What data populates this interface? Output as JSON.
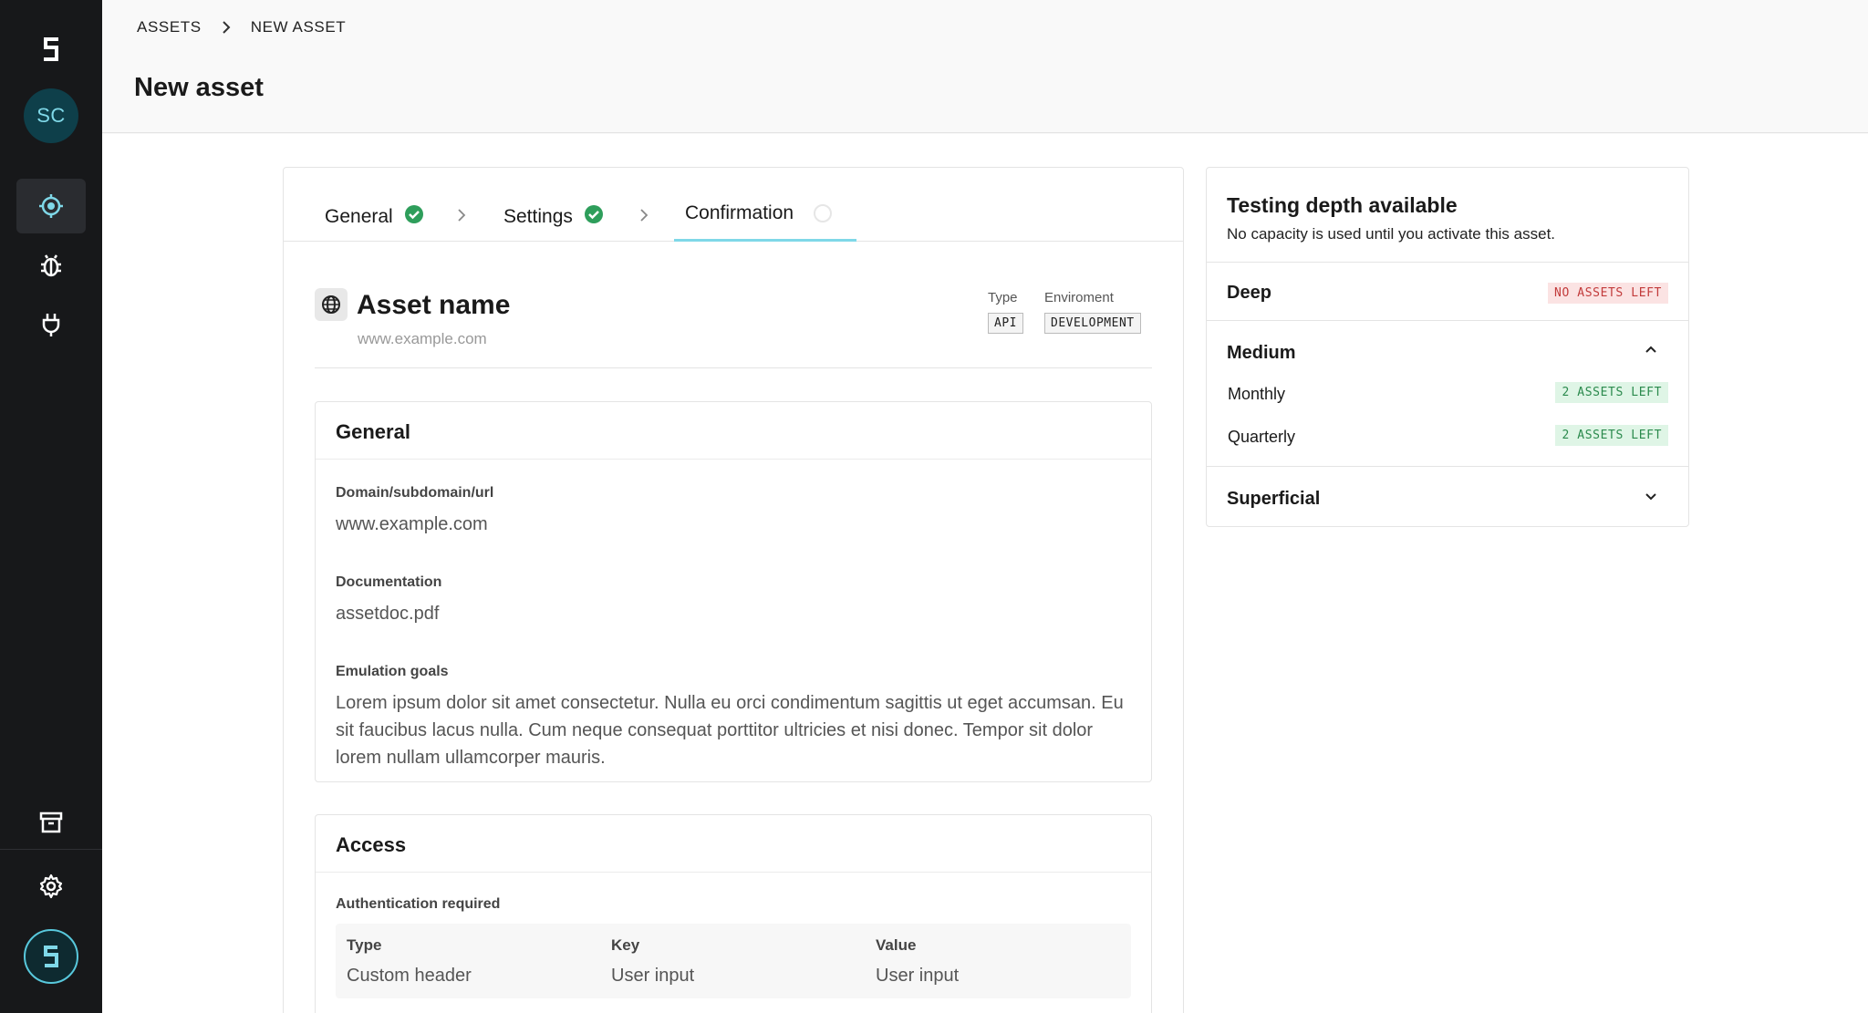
{
  "breadcrumb": {
    "items": [
      "ASSETS",
      "NEW ASSET"
    ]
  },
  "page": {
    "title": "New asset"
  },
  "sidebar": {
    "avatar_initials": "SC",
    "nav": [
      {
        "name": "targets",
        "icon": "crosshair-icon",
        "active": true
      },
      {
        "name": "bugs",
        "icon": "bug-icon",
        "active": false
      },
      {
        "name": "integrations",
        "icon": "plug-icon",
        "active": false
      }
    ],
    "bottom": [
      {
        "name": "archive",
        "icon": "archive-icon"
      },
      {
        "name": "settings",
        "icon": "gear-icon"
      }
    ]
  },
  "wizard": {
    "tabs": [
      {
        "label": "General",
        "status": "complete"
      },
      {
        "label": "Settings",
        "status": "complete"
      },
      {
        "label": "Confirmation",
        "status": "current"
      }
    ],
    "asset": {
      "name": "Asset name",
      "url": "www.example.com",
      "type_label": "Type",
      "type_value": "API",
      "env_label": "Enviroment",
      "env_value": "DEVELOPMENT"
    },
    "general": {
      "title": "General",
      "domain_label": "Domain/subdomain/url",
      "domain_value": "www.example.com",
      "doc_label": "Documentation",
      "doc_value": "assetdoc.pdf",
      "goals_label": "Emulation goals",
      "goals_value": "Lorem ipsum dolor sit amet consectetur. Nulla eu orci condimentum sagittis ut eget accumsan. Eu sit faucibus lacus nulla. Cum neque consequat porttitor ultricies et nisi donec. Tempor sit dolor lorem nullam ullamcorper mauris."
    },
    "access": {
      "title": "Access",
      "auth_label": "Authentication required",
      "columns": [
        "Type",
        "Key",
        "Value"
      ],
      "row": [
        "Custom header",
        "User input",
        "User input"
      ]
    }
  },
  "depth": {
    "title": "Testing depth available",
    "subtitle": "No capacity is used until you activate this asset.",
    "deep": {
      "label": "Deep",
      "badge": "NO ASSETS LEFT"
    },
    "medium": {
      "label": "Medium",
      "items": [
        {
          "label": "Monthly",
          "badge": "2 ASSETS LEFT"
        },
        {
          "label": "Quarterly",
          "badge": "2 ASSETS LEFT"
        }
      ]
    },
    "superficial": {
      "label": "Superficial"
    }
  },
  "colors": {
    "sidebar": "#17181a",
    "accent": "#7fd8e8",
    "success": "#2e9e5b",
    "danger": "#c23b3b"
  }
}
